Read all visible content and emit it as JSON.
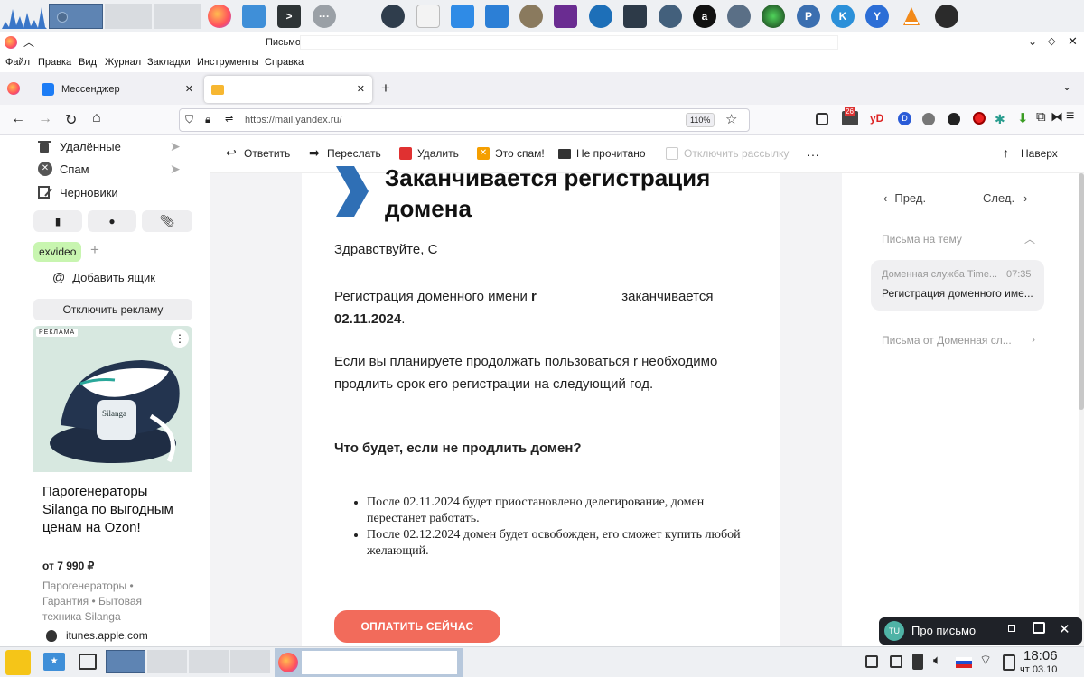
{
  "window": {
    "title": "Письмо"
  },
  "menu": [
    "Файл",
    "Правка",
    "Вид",
    "Журнал",
    "Закладки",
    "Инструменты",
    "Справка"
  ],
  "tabs": [
    {
      "label": "Мессенджер"
    },
    {
      "label": ""
    }
  ],
  "address": {
    "url": "https://mail.yandex.ru/",
    "zoom": "110%",
    "badge_count": "26",
    "yd_label": "yD"
  },
  "folders": [
    {
      "label": "Удалённые"
    },
    {
      "label": "Спам"
    },
    {
      "label": "Черновики"
    }
  ],
  "label_tag": "exvideo",
  "add_mailbox": "Добавить ящик",
  "disable_ads": "Отключить рекламу",
  "ad": {
    "badge": "РЕКЛАМА",
    "brand": "Silanga",
    "title": "Парогенераторы Silanga по выгодным ценам на Ozon!",
    "price": "от 7 990 ₽",
    "categories": "Парогенераторы • Гарантия • Бытовая техника Silanga",
    "source": "itunes.apple.com"
  },
  "toolbar": {
    "reply": "Ответить",
    "forward": "Переслать",
    "delete": "Удалить",
    "spam": "Это спам!",
    "unread": "Не прочитано",
    "unsubscribe": "Отключить рассылку",
    "more": "···",
    "top": "Наверх"
  },
  "letter": {
    "heading_line1": "Заканчивается регистрация",
    "heading_line2": "домена",
    "greeting": "Здравствуйте, С",
    "p1_a": "Регистрация доменного имени",
    "p1_mark": "r",
    "p1_b": "заканчивается",
    "p1_date": "02.11.2024",
    "p1_dot": ".",
    "p2_a": "Если вы планируете продолжать пользоваться",
    "p2_mark": "r",
    "p2_b": "необходимо продлить срок его регистрации на следующий год.",
    "subheading": "Что будет, если не продлить домен?",
    "bullets": [
      "После 02.11.2024 будет приостановлено делегирование, домен перестанет работать.",
      "После 02.12.2024 домен будет освобожден, его сможет купить любой желающий."
    ],
    "pay_button": "ОПЛАТИТЬ СЕЙЧАС"
  },
  "right": {
    "prev": "Пред.",
    "next": "След.",
    "thread_title": "Письма на тему",
    "thread_item_sender": "Доменная служба Time...",
    "thread_item_time": "07:35",
    "thread_item_subject": "Регистрация доменного име...",
    "from_sender": "Письма от Доменная сл..."
  },
  "popup": {
    "avatar": "TU",
    "label": "Про письмо"
  },
  "clock": {
    "time": "18:06",
    "date": "чт 03.10"
  },
  "colors": {
    "accent_orange": "#f26b5b",
    "yandex_red": "#e03131",
    "tab_active": "#ffffff"
  }
}
